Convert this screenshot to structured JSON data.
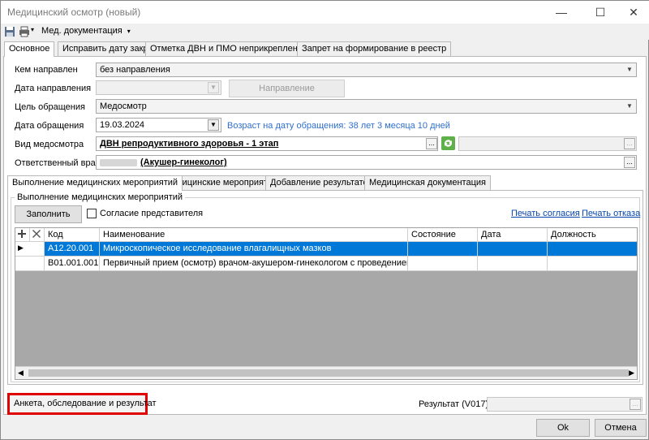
{
  "window": {
    "title": "Медицинский осмотр (новый)",
    "controls": {
      "minimize": "—",
      "maximize": "☐",
      "close": "✕"
    }
  },
  "toolbar": {
    "menu_label": "Мед. документация"
  },
  "top_tabs": [
    {
      "label": "Основное"
    },
    {
      "label": "Исправить дату закрытия"
    },
    {
      "label": "Отметка ДВН и ПМО неприкрепленные"
    },
    {
      "label": "Запрет на формирование в реестр"
    }
  ],
  "form": {
    "kem_napravlen": {
      "label": "Кем направлен",
      "value": "без направления"
    },
    "data_napravleniya": {
      "label": "Дата направления",
      "value": ""
    },
    "napravlenie_button": "Направление",
    "tsel_obrascheniya": {
      "label": "Цель обращения",
      "value": "Медосмотр"
    },
    "data_obrascheniya": {
      "label": "Дата обращения",
      "value": "19.03.2024"
    },
    "age_info": "Возраст на дату обращения: 38 лет 3 месяца 10 дней",
    "vid_medosmotra": {
      "label": "Вид медосмотра",
      "value": "ДВН репродуктивного здоровья - 1 этап"
    },
    "otv_vrach": {
      "label": "Ответственный врач",
      "value": "(Акушер-гинеколог)"
    }
  },
  "inner_tabs": [
    {
      "label": "Выполнение медицинских мероприятий"
    },
    {
      "label": "Медицинские мероприятия"
    },
    {
      "label": "Добавление результатов"
    },
    {
      "label": "Медицинская документация"
    }
  ],
  "group": {
    "title": "Выполнение медицинских мероприятий",
    "fill_button": "Заполнить",
    "consent_checkbox": "Согласие представителя",
    "print_consent": "Печать согласия",
    "print_refusal": "Печать отказа"
  },
  "table": {
    "columns": [
      "Код",
      "Наименование",
      "Состояние",
      "Дата",
      "Должность"
    ],
    "rows": [
      {
        "code": "A12.20.001",
        "name": "Микроскопическое исследование влагалищных мазков",
        "state": "",
        "date": "",
        "position": ""
      },
      {
        "code": "B01.001.001",
        "name": "Первичный прием (осмотр) врачом-акушером-гинекологом с проведением пальпа...",
        "state": "",
        "date": "",
        "position": ""
      }
    ]
  },
  "bottom": {
    "anketa_button": "Анкета, обследование и результат",
    "result_label": "Результат (V017)",
    "result_value": "",
    "ok_button": "Ok",
    "cancel_button": "Отмена"
  },
  "colors": {
    "highlight": "#e00000",
    "selection": "#0078d7",
    "link": "#0645ad"
  }
}
